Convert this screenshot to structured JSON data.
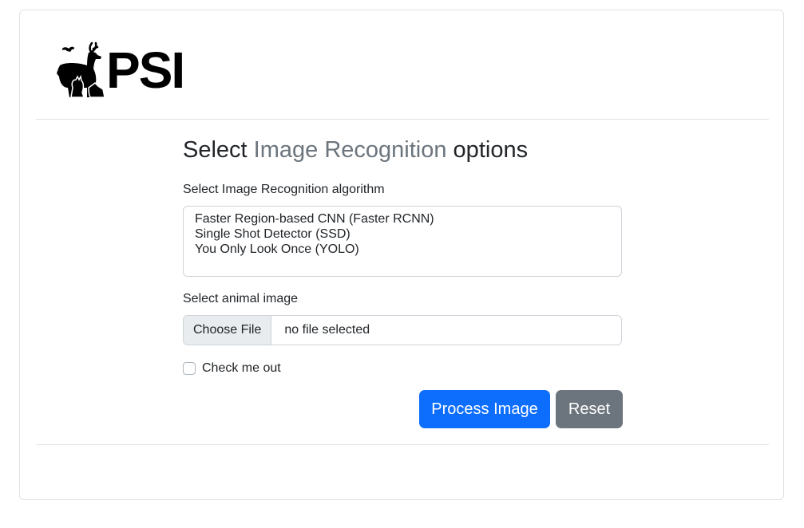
{
  "brand": {
    "logo_text": "PSI",
    "logo_icon": "animals-logo-icon"
  },
  "heading": {
    "part1": "Select ",
    "part2": "Image Recognition",
    "part3": " options"
  },
  "algorithm": {
    "label": "Select Image Recognition algorithm",
    "options": [
      "Faster Region-based CNN (Faster RCNN)",
      "Single Shot Detector (SSD)",
      "You Only Look Once (YOLO)"
    ]
  },
  "image": {
    "label": "Select animal image",
    "button": "Choose File",
    "status": "no file selected"
  },
  "checkbox": {
    "label": "Check me out",
    "checked": false
  },
  "actions": {
    "process": "Process Image",
    "reset": "Reset"
  },
  "colors": {
    "primary": "#0d6efd",
    "secondary": "#6c757d",
    "muted_text": "#6c757d",
    "border": "#dee2e6"
  }
}
